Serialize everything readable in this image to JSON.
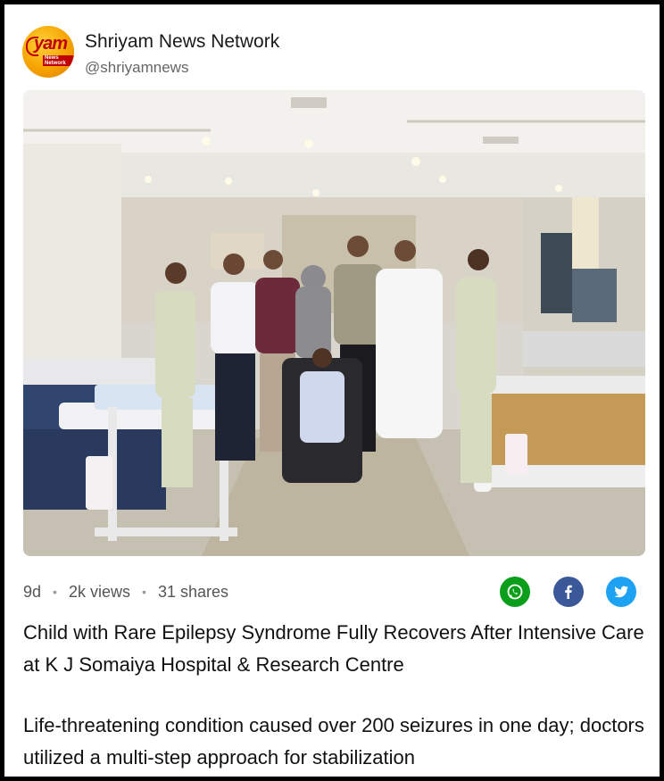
{
  "post": {
    "source_name": "Shriyam News Network",
    "source_handle": "@shriyamnews",
    "logo_text": "yam",
    "logo_subtext": "News Network",
    "age": "9d",
    "views": "2k views",
    "shares": "31 shares",
    "title": "Child with Rare Epilepsy Syndrome Fully Recovers After Intensive Care at K J Somaiya Hospital & Research Centre",
    "summary": "Life-threatening condition caused over 200 seizures in one day; doctors utilized a multi-step approach for stabilization"
  },
  "share_buttons": [
    {
      "icon": "whatsapp-icon",
      "color": "#0a9e1b"
    },
    {
      "icon": "facebook-icon",
      "color": "#3b5998"
    },
    {
      "icon": "twitter-icon",
      "color": "#1da1f2"
    }
  ],
  "colors": {
    "background": "#000000",
    "card": "#ffffff",
    "meta_text": "#555555"
  }
}
